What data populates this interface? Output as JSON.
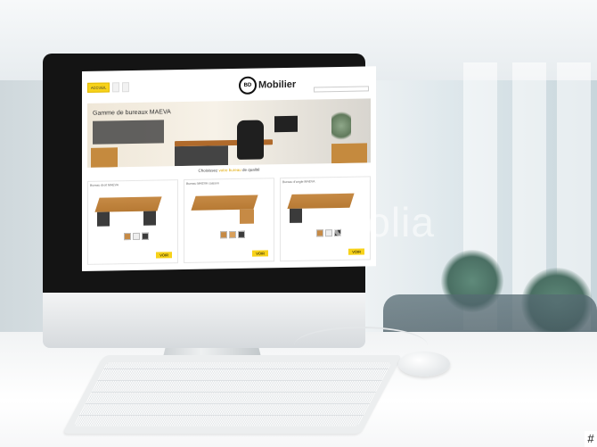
{
  "website": {
    "logo": {
      "badge": "BD",
      "name": "Mobilier"
    },
    "nav": {
      "home": "ACCUEIL"
    },
    "banner": {
      "title": "Gamme de bureaux MAEVA"
    },
    "tagline": {
      "pre": "Choisissez ",
      "highlight": "votre bureau",
      "post": " de qualité"
    },
    "products": [
      {
        "title": "Bureau droit MAEVA",
        "cta": "VOIR"
      },
      {
        "title": "Bureau MAEVA caisson",
        "cta": "VOIR"
      },
      {
        "title": "Bureau d'angle MAEVA",
        "cta": "VOIR"
      }
    ],
    "colors": {
      "accent": "#f7d21a",
      "wood": "#c68a45",
      "dark": "#3b3b3b"
    }
  },
  "watermark": "otolia",
  "corner_mark": "#"
}
